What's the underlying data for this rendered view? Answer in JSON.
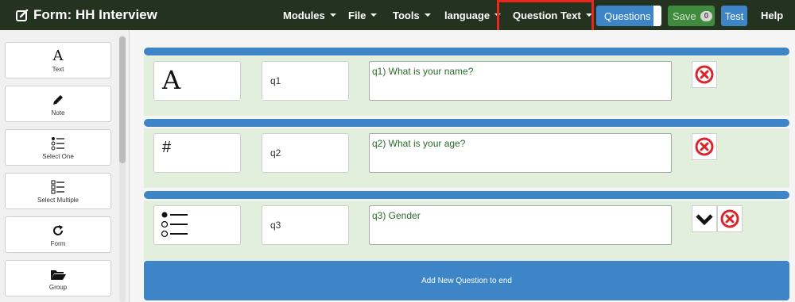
{
  "app": {
    "title": "Form: HH Interview"
  },
  "nav": {
    "modules": "Modules",
    "file": "File",
    "tools": "Tools",
    "language": "language",
    "question_text": "Question Text",
    "questions_btn": "Questions",
    "save_btn": "Save",
    "save_count": "0",
    "test_btn": "Test",
    "help": "Help"
  },
  "sidebar": {
    "tools": [
      {
        "label": "Text",
        "icon": "text-icon"
      },
      {
        "label": "Note",
        "icon": "pencil-icon"
      },
      {
        "label": "Select One",
        "icon": "radio-list-icon"
      },
      {
        "label": "Select Multiple",
        "icon": "checkbox-list-icon"
      },
      {
        "label": "Form",
        "icon": "refresh-icon"
      },
      {
        "label": "Group",
        "icon": "folder-icon"
      }
    ]
  },
  "questions": [
    {
      "icon": "text-icon",
      "id": "q1",
      "text": "q1) What is your name?",
      "has_move": false
    },
    {
      "icon": "number-icon",
      "id": "q2",
      "text": "q2) What is your age?",
      "has_move": false
    },
    {
      "icon": "radio-list-icon",
      "id": "q3",
      "text": "q3) Gender",
      "has_move": true
    }
  ],
  "add_question_label": "Add New Question to end",
  "colors": {
    "navbar": "#233320",
    "primary_blue": "#3d85c6",
    "save_green": "#3f8a3c",
    "question_bg": "#e1efdc",
    "highlight_red": "#e8261e",
    "delete_red": "#d9262c"
  }
}
